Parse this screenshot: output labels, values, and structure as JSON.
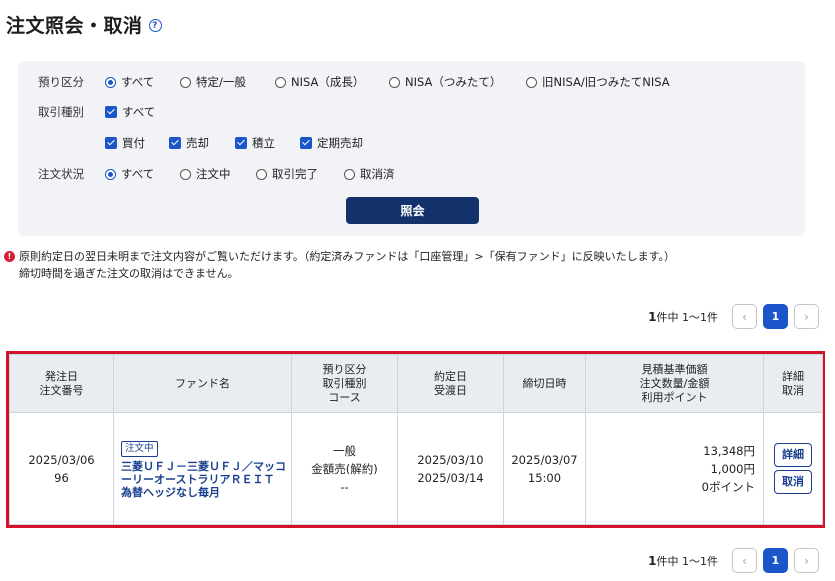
{
  "page": {
    "title": "注文照会・取消",
    "help_icon": "?"
  },
  "filters": {
    "account_label": "預り区分",
    "account_options": [
      {
        "label": "すべて",
        "selected": true
      },
      {
        "label": "特定/一般",
        "selected": false
      },
      {
        "label": "NISA（成長）",
        "selected": false
      },
      {
        "label": "NISA（つみたて）",
        "selected": false
      },
      {
        "label": "旧NISA/旧つみたてNISA",
        "selected": false
      }
    ],
    "trade_label": "取引種別",
    "trade_all": {
      "label": "すべて",
      "checked": true
    },
    "trade_options": [
      {
        "label": "買付",
        "checked": true
      },
      {
        "label": "売却",
        "checked": true
      },
      {
        "label": "積立",
        "checked": true
      },
      {
        "label": "定期売却",
        "checked": true
      }
    ],
    "status_label": "注文状況",
    "status_options": [
      {
        "label": "すべて",
        "selected": true
      },
      {
        "label": "注文中",
        "selected": false
      },
      {
        "label": "取引完了",
        "selected": false
      },
      {
        "label": "取消済",
        "selected": false
      }
    ],
    "search_button": "照会"
  },
  "notice": {
    "icon": "!",
    "line1": "原則約定日の翌日未明まで注文内容がご覧いただけます。（約定済みファンドは「口座管理」>「保有ファンド」に反映いたします。）",
    "line2": "締切時間を過ぎた注文の取消はできません。"
  },
  "pager": {
    "total": "1",
    "total_suffix": "件中 1〜1件",
    "prev": "‹",
    "page": "1",
    "next": "›"
  },
  "table": {
    "headers": {
      "col1": [
        "発注日",
        "注文番号"
      ],
      "col2": [
        "ファンド名"
      ],
      "col3": [
        "預り区分",
        "取引種別",
        "コース"
      ],
      "col4": [
        "約定日",
        "受渡日"
      ],
      "col5": [
        "締切日時"
      ],
      "col6": [
        "見積基準価額",
        "注文数量/金額",
        "利用ポイント"
      ],
      "col7": [
        "詳細",
        "取消"
      ]
    },
    "rows": [
      {
        "order_date": "2025/03/06",
        "order_no": "96",
        "status_badge": "注文中",
        "fund_name": "三菱ＵＦＪ－三菱ＵＦＪ／マッコーリーオーストラリアＲＥＩＴ　為替ヘッジなし毎月",
        "account": "一般",
        "trade_type": "金額売(解約)",
        "course": "--",
        "contract_date": "2025/03/10",
        "settle_date": "2025/03/14",
        "deadline_date": "2025/03/07",
        "deadline_time": "15:00",
        "est_price": "13,348円",
        "amount": "1,000円",
        "points": "0ポイント",
        "detail_button": "詳細",
        "cancel_button": "取消"
      }
    ]
  },
  "colors": {
    "primary": "#1a56c9",
    "navy_button": "#13326b",
    "highlight_border": "#d3132a",
    "panel_bg": "#f1f3f7"
  }
}
